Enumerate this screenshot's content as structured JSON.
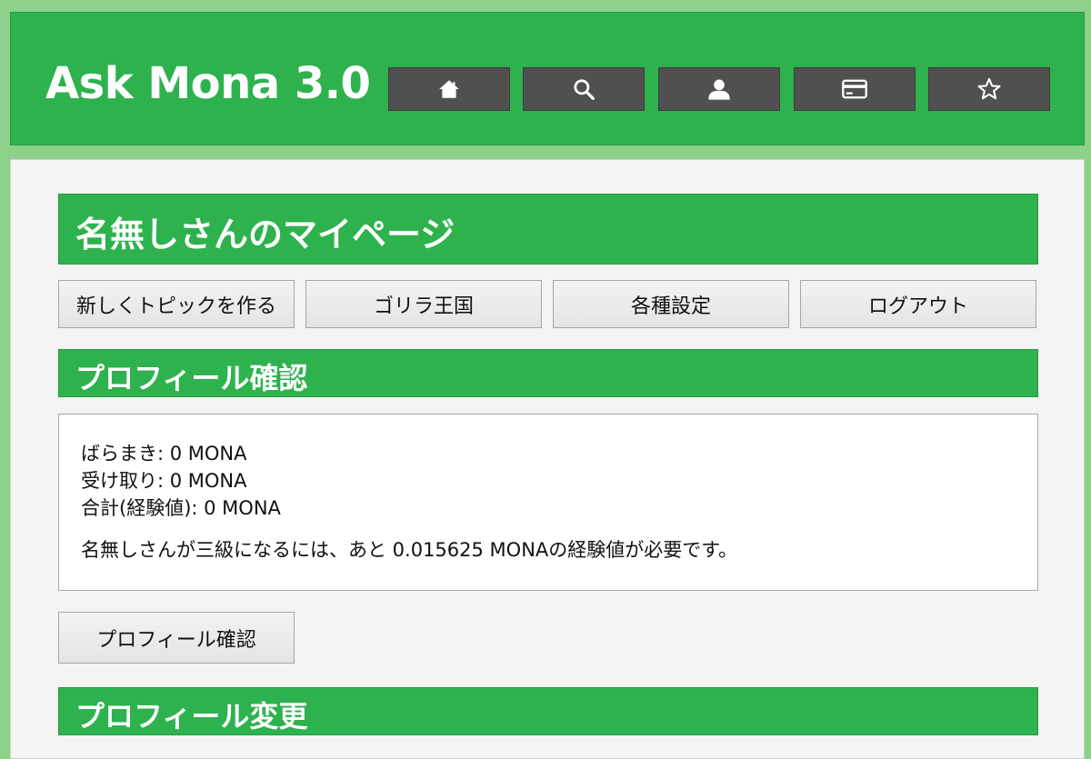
{
  "header": {
    "logo": "Ask Mona 3.0",
    "nav": [
      {
        "icon": "home-icon"
      },
      {
        "icon": "search-icon"
      },
      {
        "icon": "user-icon"
      },
      {
        "icon": "card-icon"
      },
      {
        "icon": "star-icon"
      }
    ]
  },
  "page": {
    "title": "名無しさんのマイページ",
    "actions": [
      "新しくトピックを作る",
      "ゴリラ王国",
      "各種設定",
      "ログアウト"
    ],
    "profile_section_title": "プロフィール確認",
    "profile": {
      "scatter": "ばらまき: 0 MONA",
      "received": "受け取り: 0 MONA",
      "total": "合計(経験値): 0 MONA",
      "note": "名無しさんが三級になるには、あと 0.015625 MONAの経験値が必要です。"
    },
    "profile_button": "プロフィール確認",
    "edit_section_title": "プロフィール変更"
  },
  "colors": {
    "accent": "#2eb24e",
    "background": "#8fd18b",
    "nav_button": "#505050"
  }
}
